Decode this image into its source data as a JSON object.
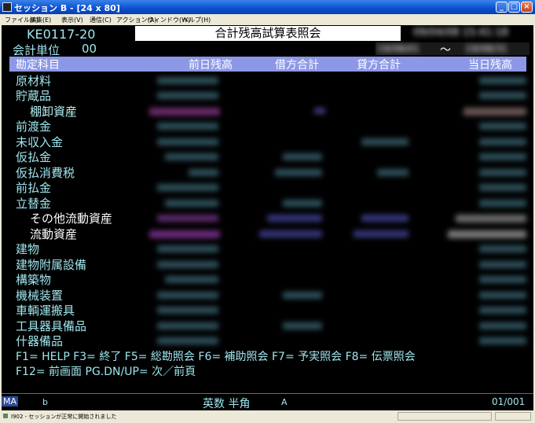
{
  "window": {
    "title": "セッション B - [24 x 80]",
    "minimize_glyph": "_",
    "maximize_glyph": "□",
    "close_glyph": "×"
  },
  "menu": [
    "ファイル(F)",
    "編集(E)",
    "表示(V)",
    "通信(C)",
    "アクション(A)",
    "ウィンドウ(W)",
    "ヘルプ(H)"
  ],
  "screen": {
    "program_id": "KE0117-20",
    "title": "合計残高試算表照会",
    "unit_label": "会計単位",
    "unit_value": "00",
    "datetime": "09/04/08 15:41:18",
    "date_from": "19/08/01",
    "date_sep": "～",
    "date_to": "19/08/31"
  },
  "columns": {
    "account": "勘定科目",
    "prev_balance": "前日残高",
    "debit_total": "借方合計",
    "credit_total": "貸方合計",
    "current_balance": "当日残高"
  },
  "accounts": [
    "原材料",
    "貯蔵品",
    "棚卸資産",
    "前渡金",
    "未収入金",
    "仮払金",
    "仮払消費税",
    "前払金",
    "立替金",
    "その他流動資産",
    "流動資産",
    "建物",
    "建物附属設備",
    "構築物",
    "機械装置",
    "車輌運搬具",
    "工具器具備品",
    "什器備品"
  ],
  "function_keys": {
    "line1": "F1= HELP  F3= 終了  F5= 総勘照会  F6= 補助照会  F7= 予実照会  F8= 伝票照会",
    "line2": "F12= 前画面  PG.DN/UP= 次／前頁"
  },
  "terminal_status": {
    "indicator": "MA",
    "cursor_char": "b",
    "input_mode": "英数 半角",
    "mode_flag": "A",
    "page": "01/001"
  },
  "window_status": {
    "message": "I902 - セッションが正常に開始されました"
  },
  "colors": {
    "terminal_bg": "#000000",
    "text_cyan": "#9fe6ee",
    "column_bar": "#8c98e6",
    "title_bar": "#0a4fd0"
  }
}
